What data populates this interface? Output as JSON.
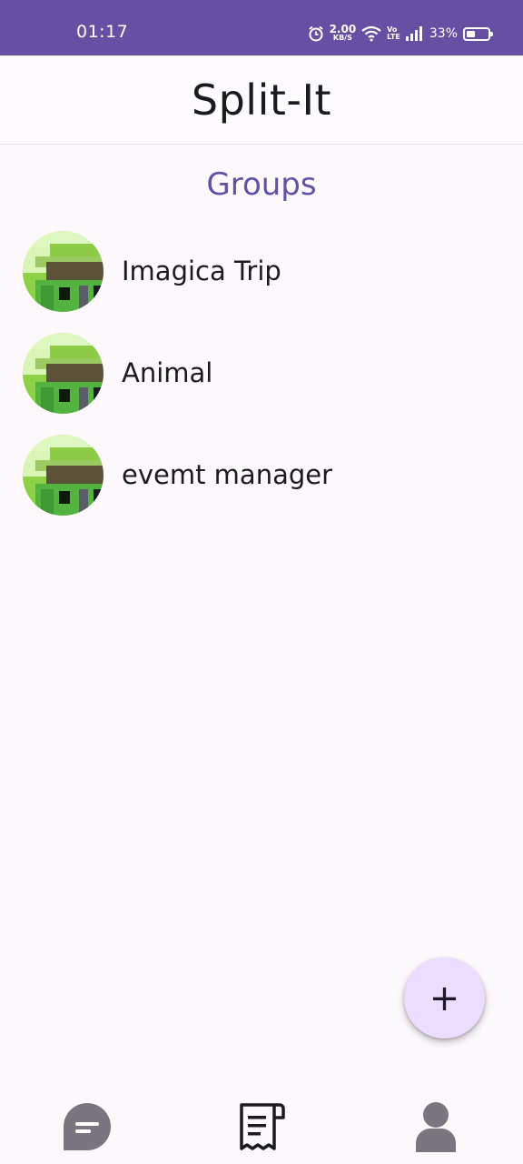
{
  "status_bar": {
    "time": "01:17",
    "net_speed_value": "2.00",
    "net_speed_unit": "KB/S",
    "volte_top": "Vo",
    "volte_bottom": "LTE",
    "battery_percent": "33%",
    "battery_level": 0.33,
    "color": "#6650a4"
  },
  "app_bar": {
    "title": "Split-It"
  },
  "groups": {
    "heading": "Groups",
    "items": [
      {
        "name": "Imagica Trip",
        "avatar": "group-avatar"
      },
      {
        "name": "Animal",
        "avatar": "group-avatar"
      },
      {
        "name": "evemt manager",
        "avatar": "group-avatar"
      }
    ]
  },
  "fab": {
    "icon": "plus-icon",
    "label": "+"
  },
  "bottom_nav": {
    "items": [
      {
        "icon": "chat-icon"
      },
      {
        "icon": "receipt-icon"
      },
      {
        "icon": "person-icon"
      }
    ]
  },
  "colors": {
    "accent": "#6650a4",
    "fab_bg": "#eaddff",
    "background": "#fdf8fc",
    "nav_icon": "#7a757f"
  }
}
